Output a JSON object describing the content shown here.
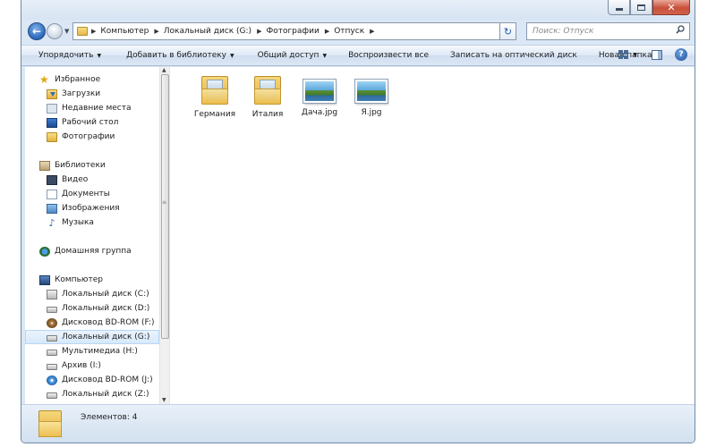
{
  "address": {
    "crumbs": [
      "Компьютер",
      "Локальный диск (G:)",
      "Фотографии",
      "Отпуск"
    ]
  },
  "search": {
    "placeholder": "Поиск: Отпуск"
  },
  "toolbar": {
    "organize": "Упорядочить",
    "add_to_library": "Добавить в библиотеку",
    "share": "Общий доступ",
    "play_all": "Воспроизвести все",
    "burn": "Записать на оптический диск",
    "new_folder": "Новая папка"
  },
  "nav": {
    "favorites": {
      "header": "Избранное",
      "items": [
        "Загрузки",
        "Недавние места",
        "Рабочий стол",
        "Фотографии"
      ]
    },
    "libraries": {
      "header": "Библиотеки",
      "items": [
        "Видео",
        "Документы",
        "Изображения",
        "Музыка"
      ]
    },
    "homegroup": "Домашняя группа",
    "computer": {
      "header": "Компьютер",
      "items": [
        "Локальный диск (C:)",
        "Локальный диск (D:)",
        "Дисковод BD-ROM (F:)",
        "Локальный диск (G:)",
        "Мультимедиа (H:)",
        "Архив (I:)",
        "Дисковод BD-ROM (J:)",
        "Локальный диск (Z:)"
      ],
      "selected": "Локальный диск (G:)"
    }
  },
  "files": [
    {
      "name": "Германия",
      "type": "folder"
    },
    {
      "name": "Италия",
      "type": "folder"
    },
    {
      "name": "Дача.jpg",
      "type": "image"
    },
    {
      "name": "Я.jpg",
      "type": "image"
    }
  ],
  "status": {
    "items_count": "Элементов: 4"
  },
  "colors": {
    "window_frame": "#dbe7f4",
    "selection": "#d7e9fb",
    "close_button": "#c8503a"
  }
}
